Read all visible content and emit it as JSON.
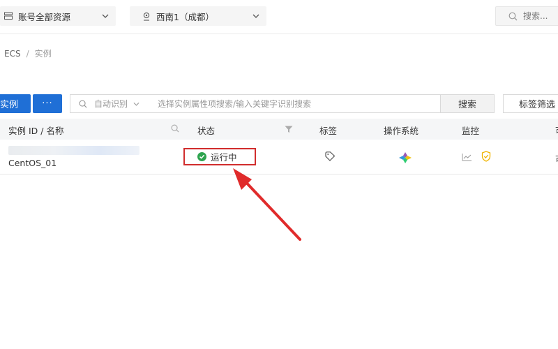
{
  "topbar": {
    "account_scope": "账号全部资源",
    "region": "西南1（成都）",
    "search_placeholder": "搜索..."
  },
  "breadcrumb": {
    "parent": "ECS",
    "separator": "/",
    "current": "实例"
  },
  "toolbar": {
    "create_label": "实例",
    "more_label": "···",
    "search_mode": "自动识别",
    "search_placeholder": "选择实例属性项搜索/输入关键字识别搜索",
    "search_button": "搜索",
    "tag_filter_label": "标签筛选"
  },
  "table": {
    "columns": [
      "实例 ID / 名称",
      "状态",
      "标签",
      "操作系统",
      "监控",
      "可"
    ],
    "rows": [
      {
        "name": "CentOS_01",
        "status": "运行中",
        "status_color": "#2ea44f"
      }
    ],
    "last_cell_partial": "可"
  },
  "colors": {
    "primary": "#1f6fd6",
    "highlight_red": "#d12d2d",
    "running_green": "#2ea44f"
  }
}
